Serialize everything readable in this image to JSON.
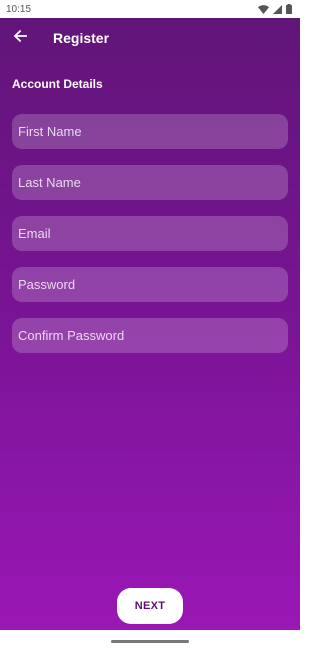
{
  "status_bar": {
    "time": "10:15",
    "icons": [
      "wifi-icon",
      "cellular-signal-icon",
      "battery-icon"
    ]
  },
  "app_bar": {
    "back_icon": "arrow-left-icon",
    "title": "Register"
  },
  "section": {
    "title": "Account Details"
  },
  "form": {
    "fields": [
      {
        "placeholder": "First Name",
        "value": ""
      },
      {
        "placeholder": "Last Name",
        "value": ""
      },
      {
        "placeholder": "Email",
        "value": ""
      },
      {
        "placeholder": "Password",
        "value": ""
      },
      {
        "placeholder": "Confirm Password",
        "value": ""
      }
    ]
  },
  "actions": {
    "next_label": "NEXT"
  },
  "colors": {
    "gradient_top": "#611578",
    "gradient_bottom": "#9a17b5",
    "field_fill": "rgba(255,255,255,0.2)",
    "button_bg": "#ffffff",
    "button_text": "#5a1070"
  }
}
